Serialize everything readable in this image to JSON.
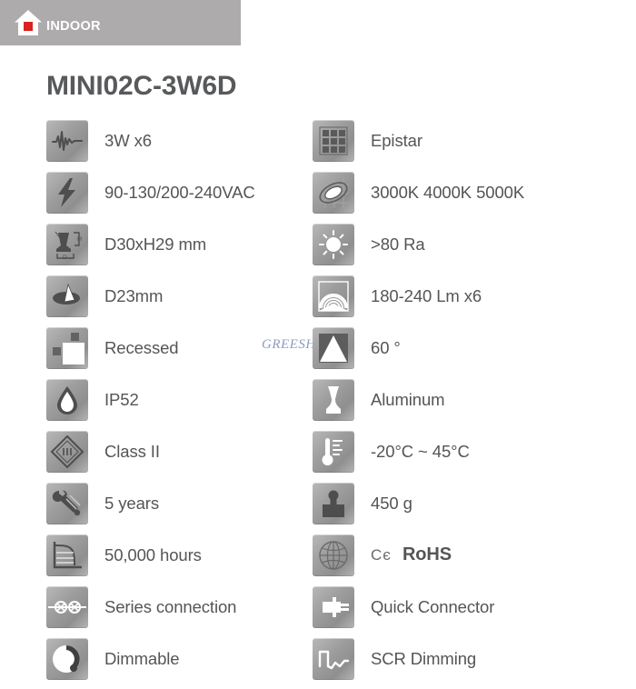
{
  "header": {
    "icon": "house-icon",
    "label": "INDOOR",
    "bg_color": "#adabab",
    "accent_color": "#d8231f"
  },
  "product": {
    "title": "MINI02C-3W6D",
    "title_color": "#58595b"
  },
  "watermark": {
    "text": "GREESHINE",
    "color": "#8e9bc4"
  },
  "specs": {
    "left": [
      {
        "icon": "power-waveform-icon",
        "label": "3W x6"
      },
      {
        "icon": "voltage-bolt-icon",
        "label": "90-130/200-240VAC"
      },
      {
        "icon": "dimensions-icon",
        "label": "D30xH29 mm"
      },
      {
        "icon": "cutout-diameter-icon",
        "label": "D23mm"
      },
      {
        "icon": "recessed-mount-icon",
        "label": "Recessed"
      },
      {
        "icon": "water-drop-ip-icon",
        "label": "IP52"
      },
      {
        "icon": "insulation-class-icon",
        "label": "Class II"
      },
      {
        "icon": "warranty-wrench-icon",
        "label": "5 years"
      },
      {
        "icon": "lifetime-chart-icon",
        "label": "50,000 hours"
      },
      {
        "icon": "series-connection-icon",
        "label": "Series connection"
      },
      {
        "icon": "dimmable-knob-icon",
        "label": "Dimmable"
      }
    ],
    "right": [
      {
        "icon": "led-chip-grid-icon",
        "label": "Epistar"
      },
      {
        "icon": "color-temperature-icon",
        "label": "3000K 4000K 5000K"
      },
      {
        "icon": "cri-sun-icon",
        "label": ">80 Ra"
      },
      {
        "icon": "luminous-flux-icon",
        "label": "180-240 Lm x6"
      },
      {
        "icon": "beam-angle-icon",
        "label": "60 °"
      },
      {
        "icon": "material-icon",
        "label": "Aluminum"
      },
      {
        "icon": "thermometer-icon",
        "label": "-20°C ~ 45°C"
      },
      {
        "icon": "weight-icon",
        "label": "450 g"
      },
      {
        "icon": "certification-globe-icon",
        "label_ce": "Cє",
        "label_rohs": "RoHS"
      },
      {
        "icon": "quick-connector-icon",
        "label": "Quick Connector"
      },
      {
        "icon": "scr-dimming-icon",
        "label": "SCR Dimming"
      }
    ]
  }
}
